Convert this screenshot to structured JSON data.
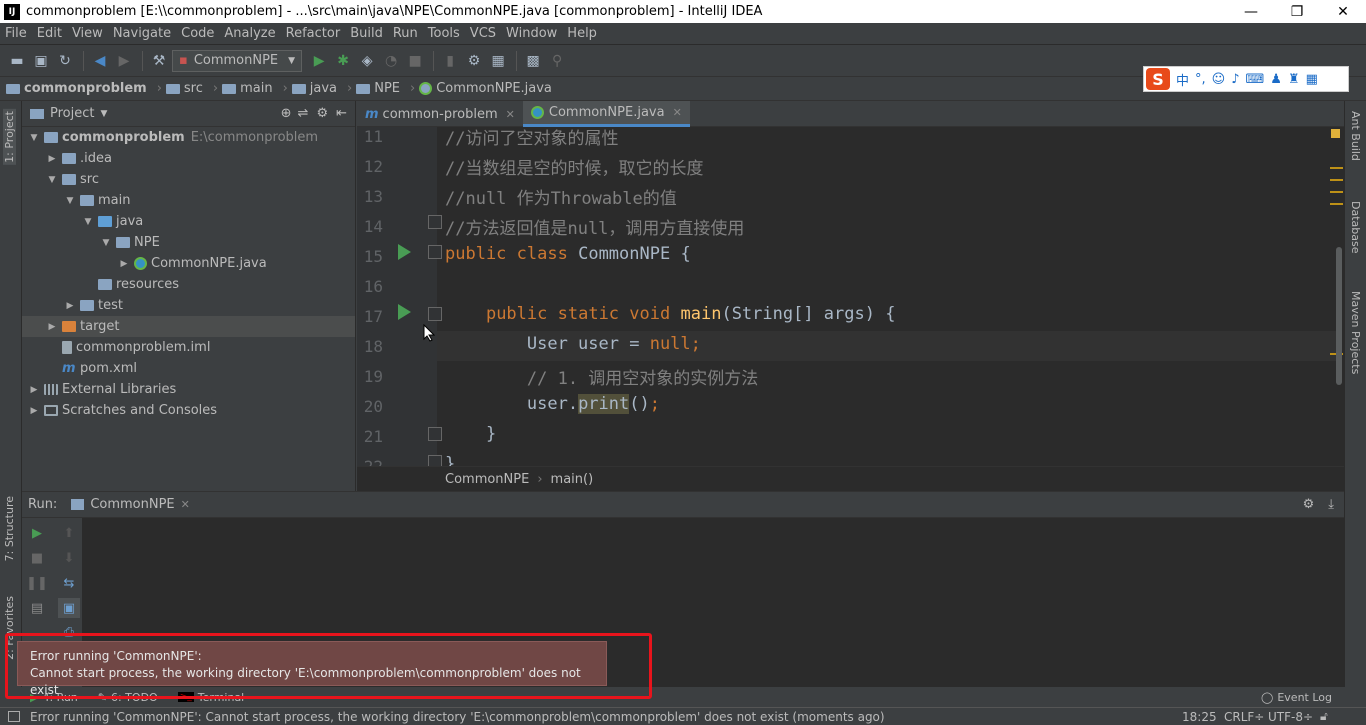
{
  "window": {
    "title": "commonproblem [E:\\\\commonproblem] - ...\\src\\main\\java\\NPE\\CommonNPE.java [commonproblem] - IntelliJ IDEA",
    "logo": "IJ",
    "minimize": "—",
    "restore": "❐",
    "close": "✕"
  },
  "menu": [
    "File",
    "Edit",
    "View",
    "Navigate",
    "Code",
    "Analyze",
    "Refactor",
    "Build",
    "Run",
    "Tools",
    "VCS",
    "Window",
    "Help"
  ],
  "toolbar": {
    "run_config": "CommonNPE"
  },
  "breadcrumb": [
    "commonproblem",
    "src",
    "main",
    "java",
    "NPE",
    "CommonNPE.java"
  ],
  "ime": {
    "logo": "S",
    "label": "中",
    "punct": "°,"
  },
  "project_panel": {
    "title": "Project",
    "tree": [
      {
        "label": "commonproblem",
        "extra": "E:\\commonproblem",
        "depth": 0,
        "arrow": "▼",
        "icon": "fold",
        "bold": true
      },
      {
        "label": ".idea",
        "depth": 1,
        "arrow": "▶",
        "icon": "fold"
      },
      {
        "label": "src",
        "depth": 1,
        "arrow": "▼",
        "icon": "fold"
      },
      {
        "label": "main",
        "depth": 2,
        "arrow": "▼",
        "icon": "fold"
      },
      {
        "label": "java",
        "depth": 3,
        "arrow": "▼",
        "icon": "fold-b"
      },
      {
        "label": "NPE",
        "depth": 4,
        "arrow": "▼",
        "icon": "fold"
      },
      {
        "label": "CommonNPE.java",
        "depth": 5,
        "arrow": "▶",
        "icon": "java"
      },
      {
        "label": "resources",
        "depth": 3,
        "arrow": "",
        "icon": "fold"
      },
      {
        "label": "test",
        "depth": 2,
        "arrow": "▶",
        "icon": "fold"
      },
      {
        "label": "target",
        "depth": 1,
        "arrow": "▶",
        "icon": "fold-o",
        "selected": true
      },
      {
        "label": "commonproblem.iml",
        "depth": 1,
        "arrow": "",
        "icon": "file"
      },
      {
        "label": "pom.xml",
        "depth": 1,
        "arrow": "",
        "icon": "maven"
      },
      {
        "label": "External Libraries",
        "depth": 0,
        "arrow": "▶",
        "icon": "lib"
      },
      {
        "label": "Scratches and Consoles",
        "depth": 0,
        "arrow": "▶",
        "icon": "scratch"
      }
    ]
  },
  "left_strip": {
    "project": "1: Project",
    "structure": "7: Structure",
    "favorites": "2: Favorites"
  },
  "right_strip": {
    "ant": "Ant Build",
    "database": "Database",
    "maven": "Maven Projects"
  },
  "editor_tabs": [
    {
      "label": "common-problem",
      "icon": "m"
    },
    {
      "label": "CommonNPE.java",
      "icon": "java",
      "active": true
    }
  ],
  "code_lines": [
    {
      "n": "11",
      "t": "//访问了空对象的属性"
    },
    {
      "n": "12",
      "t": "//当数组是空的时候，取它的长度"
    },
    {
      "n": "13",
      "t": "//null 作为Throwable的值"
    },
    {
      "n": "14",
      "t": "//方法返回值是null，调用方直接使用"
    },
    {
      "n": "15",
      "t": "public class CommonNPE {"
    },
    {
      "n": "16",
      "t": ""
    },
    {
      "n": "17",
      "t": "    public static void main(String[] args) {"
    },
    {
      "n": "18",
      "t": "        User user = null;"
    },
    {
      "n": "19",
      "t": "        // 1. 调用空对象的实例方法"
    },
    {
      "n": "20",
      "t": "        user.print();"
    },
    {
      "n": "21",
      "t": "    }"
    },
    {
      "n": "22",
      "t": "}"
    }
  ],
  "code_breadcrumb": [
    "CommonNPE",
    "main()"
  ],
  "run_panel": {
    "label": "Run:",
    "tab": "CommonNPE"
  },
  "bottom_tabs": [
    "4: Run",
    "6: TODO",
    "Terminal",
    "Event Log"
  ],
  "balloon": {
    "line1": "Error running 'CommonNPE':",
    "line2": "Cannot start process, the working directory 'E:\\commonproblem\\commonproblem' does not exist"
  },
  "status": {
    "message": "Error running 'CommonNPE': Cannot start process, the working directory 'E:\\commonproblem\\commonproblem' does not exist (moments ago)",
    "position": "18:25",
    "line_sep": "CRLF÷",
    "encoding": "UTF-8÷"
  }
}
